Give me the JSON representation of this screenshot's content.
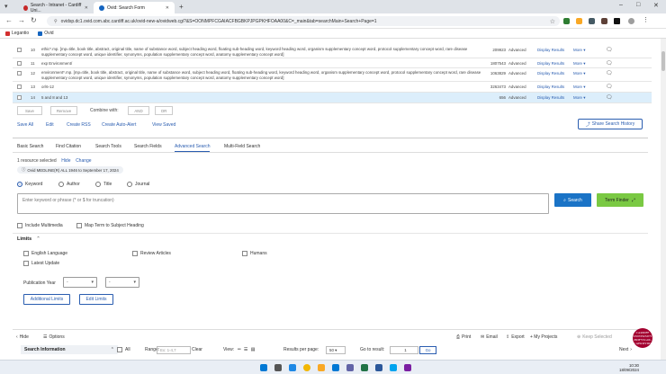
{
  "browser": {
    "tabs": [
      {
        "label": "Search - Intranet - Cardiff Uni...",
        "active": false
      },
      {
        "label": "Ovid: Search Form",
        "active": true
      }
    ],
    "new_tab": "+",
    "url": "ovidsp.dc1.ovid.com.abc.cardiff.ac.uk/ovid-new-a/ovidweb.cgi?&S=OONMPFCGAIACFBGBKPJPGPKHFOAA00&C=_main&tab=searchMain+Search+Page=1",
    "bookmarks": [
      {
        "label": "Legantio",
        "color": "#d32f2f"
      },
      {
        "label": "Ovid",
        "color": "#1565c0"
      }
    ],
    "window_controls": {
      "minimize": "–",
      "maximize": "□",
      "close": "✕"
    }
  },
  "history": {
    "rows": [
      {
        "num": "10",
        "query": "ethic*.mp. [mp=title, book title, abstract, original title, name of substance word, subject heading word, floating sub-heading word, keyword heading word, organism supplementary concept word, protocol supplementary concept word, rare disease supplementary concept word, unique identifier, synonyms, population supplementary concept word, anatomy supplementary concept word]",
        "results": "209923",
        "type": "Advanced",
        "display": "Display Results",
        "more": "More"
      },
      {
        "num": "11",
        "query": "exp Environment/",
        "results": "1807543",
        "type": "Advanced",
        "display": "Display Results",
        "more": "More"
      },
      {
        "num": "12",
        "query": "environment*.mp. [mp=title, book title, abstract, original title, name of substance word, subject heading word, floating sub-heading word, keyword heading word, organism supplementary concept word, protocol supplementary concept word, rare disease supplementary concept word, unique identifier, synonyms, population supplementary concept word, anatomy supplementary concept word]",
        "results": "1063829",
        "type": "Advanced",
        "display": "Display Results",
        "more": "More"
      },
      {
        "num": "13",
        "query": "or/6-12",
        "results": "3263473",
        "type": "Advanced",
        "display": "Display Results",
        "more": "More"
      },
      {
        "num": "14",
        "query": "5 and 8 and 13",
        "results": "656",
        "type": "Advanced",
        "display": "Display Results",
        "more": "More"
      }
    ],
    "buttons": {
      "save": "Save",
      "remove": "Remove",
      "combine_label": "Combine with:",
      "and": "AND",
      "or": "OR"
    },
    "links": [
      "Save All",
      "Edit",
      "Create RSS",
      "Create Auto-Alert",
      "View Saved"
    ],
    "share": "Share Search History"
  },
  "search_tabs": [
    "Basic Search",
    "Find Citation",
    "Search Tools",
    "Search Fields",
    "Advanced Search",
    "Multi-Field Search"
  ],
  "active_tab": "Advanced Search",
  "resource": {
    "selected": "1 resource selected",
    "hide": "Hide",
    "change": "Change",
    "chip": "Ovid MEDLINE(R) ALL 1946 to September 17, 2024"
  },
  "fields": {
    "options": [
      "Keyword",
      "Author",
      "Title",
      "Journal"
    ],
    "selected": "Keyword",
    "placeholder": "Enter keyword or phrase (* or $ for truncation)",
    "search_btn": "Search",
    "term_finder": "Term Finder",
    "include_multimedia": "Include Multimedia",
    "map_term": "Map Term to Subject Heading"
  },
  "limits": {
    "title": "Limits",
    "checks": [
      "English Language",
      "Review Articles",
      "Humans",
      "Latest Update"
    ],
    "pub_year_label": "Publication Year",
    "pub_from": "-",
    "pub_to": "-",
    "additional": "Additional Limits",
    "edit": "Edit Limits"
  },
  "results_toolbar": {
    "hide": "Hide",
    "options": "Options",
    "search_info": "Search Information",
    "all": "All",
    "range_label": "Range:",
    "range_placeholder": "Ex: 1-4,7",
    "clear": "Clear",
    "view": "View:",
    "per_page_label": "Results per page:",
    "per_page": "50",
    "goto_label": "Go to result:",
    "goto_value": "1",
    "go": "Go",
    "print": "Print",
    "email": "Email",
    "export": "Export",
    "my_projects": "+ My Projects",
    "keep": "Keep Selected",
    "next": "Next"
  },
  "logo_text": "CARDIFF UNIVERSITY PRIFYSGOL CAERDYDD",
  "taskbar": {
    "time": "10:30",
    "date": "18/09/2024"
  }
}
